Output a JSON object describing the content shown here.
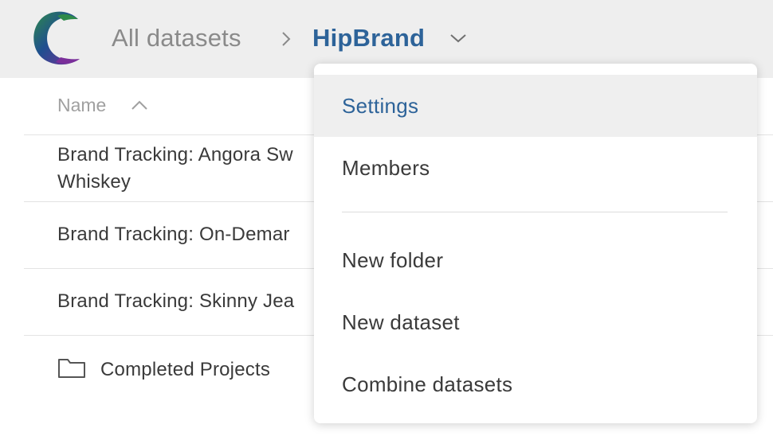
{
  "header": {
    "logo_icon": "app-logo",
    "breadcrumb_root": "All datasets",
    "breadcrumb_separator_icon": "chevron-right-icon",
    "breadcrumb_current": "HipBrand",
    "breadcrumb_caret_icon": "chevron-down-icon",
    "accent_color": "#2d6399"
  },
  "list": {
    "column_header": "Name",
    "sort_direction": "ascending",
    "rows": [
      {
        "label": "Brand Tracking: Angora Sw\nWhiskey",
        "type": "dataset"
      },
      {
        "label": "Brand Tracking: On-Demar",
        "type": "dataset"
      },
      {
        "label": "Brand Tracking: Skinny Jea",
        "type": "dataset"
      },
      {
        "label": "Completed Projects",
        "type": "folder",
        "icon": "folder-icon"
      }
    ]
  },
  "menu": {
    "items": [
      {
        "label": "Settings",
        "active": true
      },
      {
        "label": "Members"
      },
      {
        "label": "New folder"
      },
      {
        "label": "New dataset"
      },
      {
        "label": "Combine datasets"
      }
    ]
  }
}
